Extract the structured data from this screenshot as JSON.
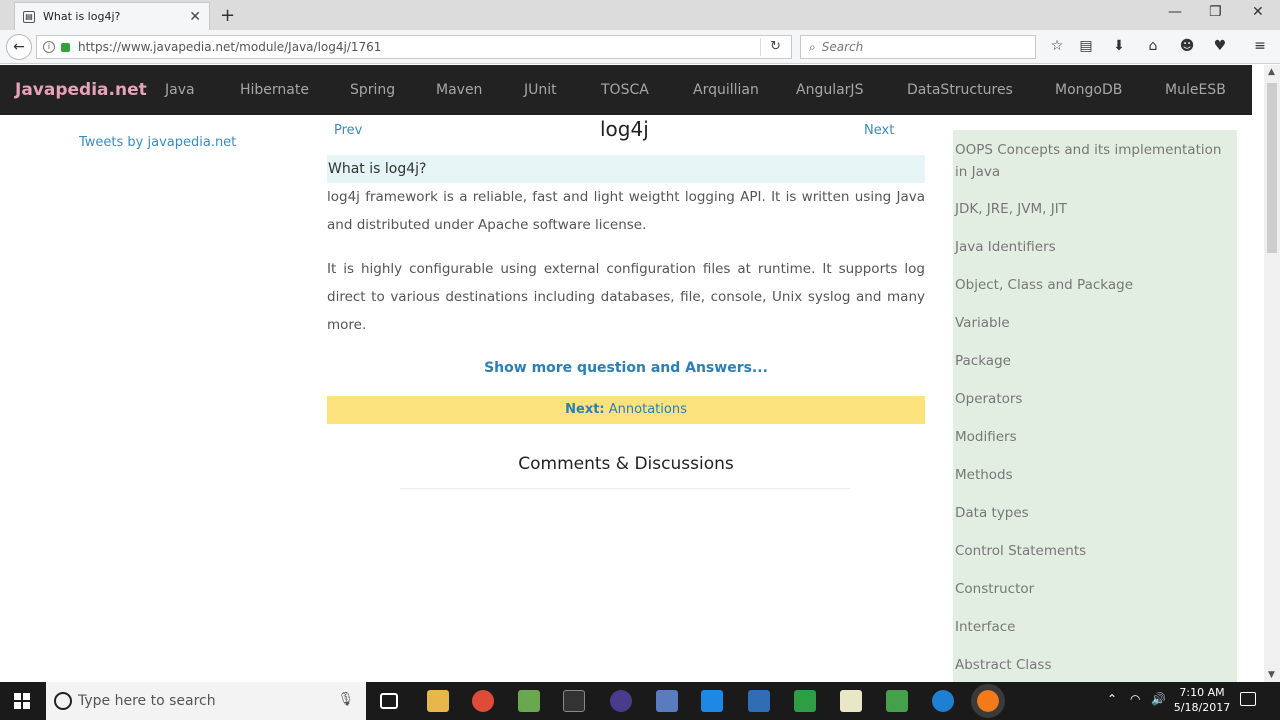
{
  "browser": {
    "tab_title": "What is log4j?",
    "url": "https://www.javapedia.net/module/Java/log4j/1761",
    "search_placeholder": "Search"
  },
  "site": {
    "brand": "Javapedia.net",
    "menu": [
      "Java",
      "Hibernate",
      "Spring",
      "Maven",
      "JUnit",
      "TOSCA",
      "Arquillian",
      "AngularJS",
      "DataStructures",
      "MongoDB",
      "MuleESB"
    ]
  },
  "page": {
    "tweets_link": "Tweets by javapedia.net",
    "prev": "Prev",
    "next": "Next",
    "title": "log4j",
    "question": "What is log4j?",
    "para1": "log4j framework is a reliable, fast and light weigtht logging API. It is written using Java and distributed under Apache software license.",
    "para2": "It is highly configurable using external configuration files at runtime. It supports log direct to various destinations including databases, file, console, Unix syslog and many more.",
    "show_more": "Show more question and Answers...",
    "next_label": "Next:",
    "next_value": "Annotations",
    "comments": "Comments & Discussions"
  },
  "sidebar": {
    "items": [
      "OOPS Concepts and its implementation in Java",
      "JDK, JRE, JVM, JIT",
      "Java Identifiers",
      "Object, Class and Package",
      "Variable",
      "Package",
      "Operators",
      "Modifiers",
      "Methods",
      "Data types",
      "Control Statements",
      "Constructor",
      "Interface",
      "Abstract Class"
    ]
  },
  "taskbar": {
    "search_placeholder": "Type here to search",
    "time": "7:10 AM",
    "date": "5/18/2017"
  }
}
